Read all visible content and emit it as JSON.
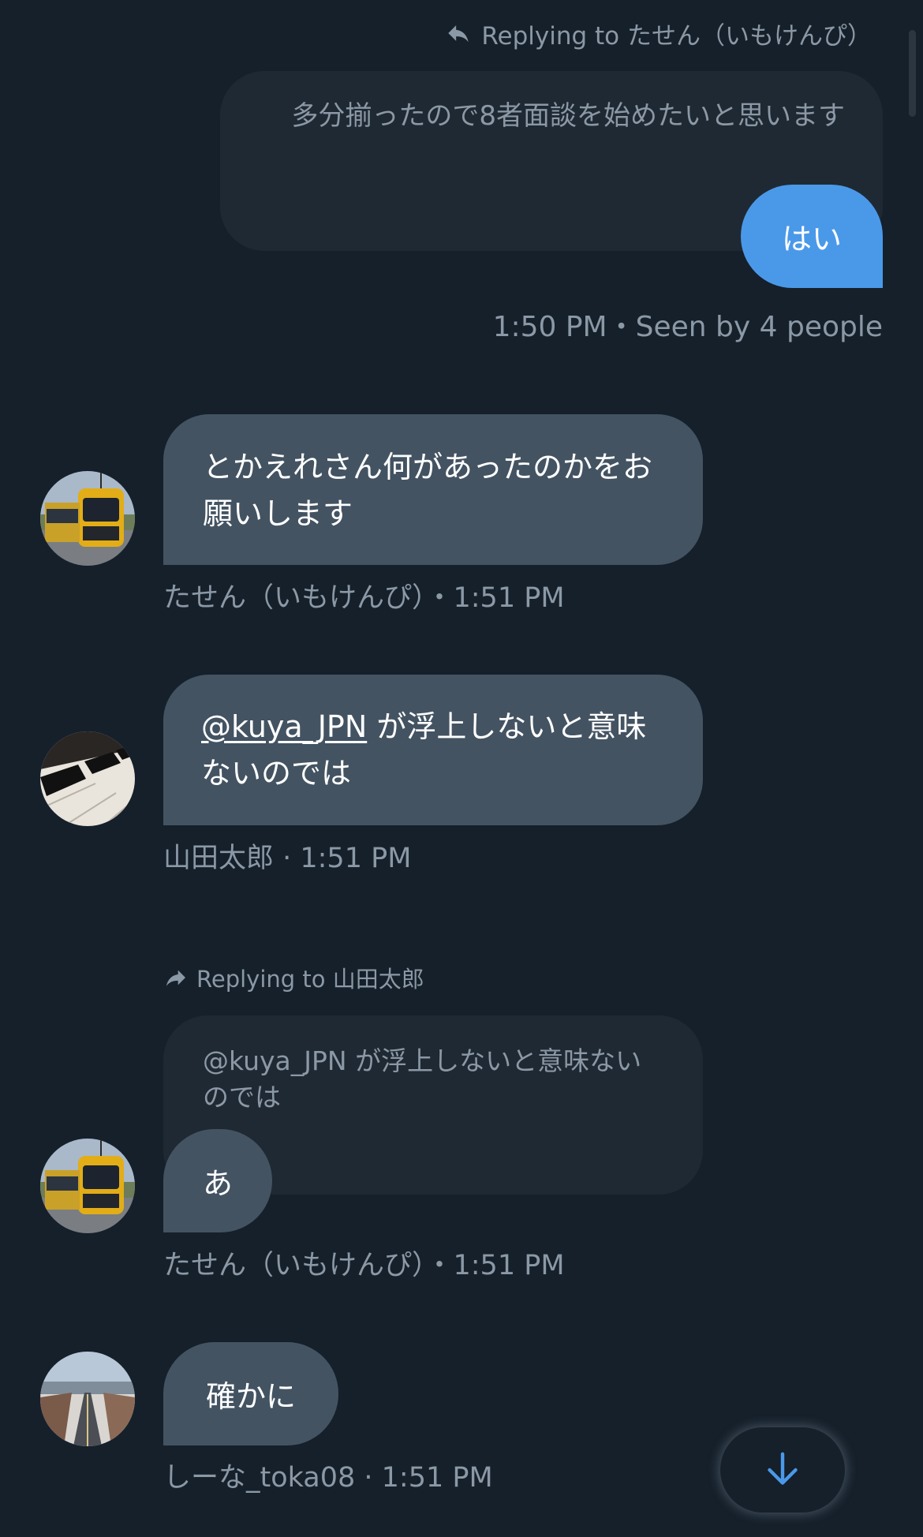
{
  "conversation": {
    "messages": [
      {
        "direction": "outgoing",
        "reply_label": "Replying to たせん（いもけんぴ）",
        "quoted_text": "多分揃ったので8者面談を始めたいと思います",
        "text": "はい",
        "meta": "1:50 PM・Seen by 4 people"
      },
      {
        "direction": "incoming",
        "avatar": "tram-avatar",
        "text": "とかえれさん何があったのかをお願いします",
        "meta": "たせん（いもけんぴ）・1:51 PM"
      },
      {
        "direction": "incoming",
        "avatar": "piano-keys-avatar",
        "mention": "@kuya_JPN",
        "text_after_mention": " が浮上しないと意味ないのでは",
        "meta": "山田太郎 · 1:51 PM"
      },
      {
        "direction": "incoming",
        "avatar": "tram-avatar",
        "reply_label": "Replying to 山田太郎",
        "quoted_text": "@kuya_JPN が浮上しないと意味ないのでは",
        "text": "あ",
        "meta": "たせん（いもけんぴ）・1:51 PM"
      },
      {
        "direction": "incoming",
        "avatar": "snowy-road-avatar",
        "text": "確かに",
        "meta": "しーな_toka08 · 1:51 PM"
      }
    ]
  },
  "icons": {
    "reply_outgoing": "reply-arrow-icon",
    "reply_incoming": "forward-arrow-icon",
    "scroll_down": "arrow-down-icon"
  },
  "colors": {
    "background": "#15202b",
    "incoming_bubble": "#435362",
    "outgoing_bubble": "#4a99e9",
    "quoted_bubble": "#1f2933",
    "secondary_text": "#8b98a5",
    "accent": "#4a99e9"
  }
}
